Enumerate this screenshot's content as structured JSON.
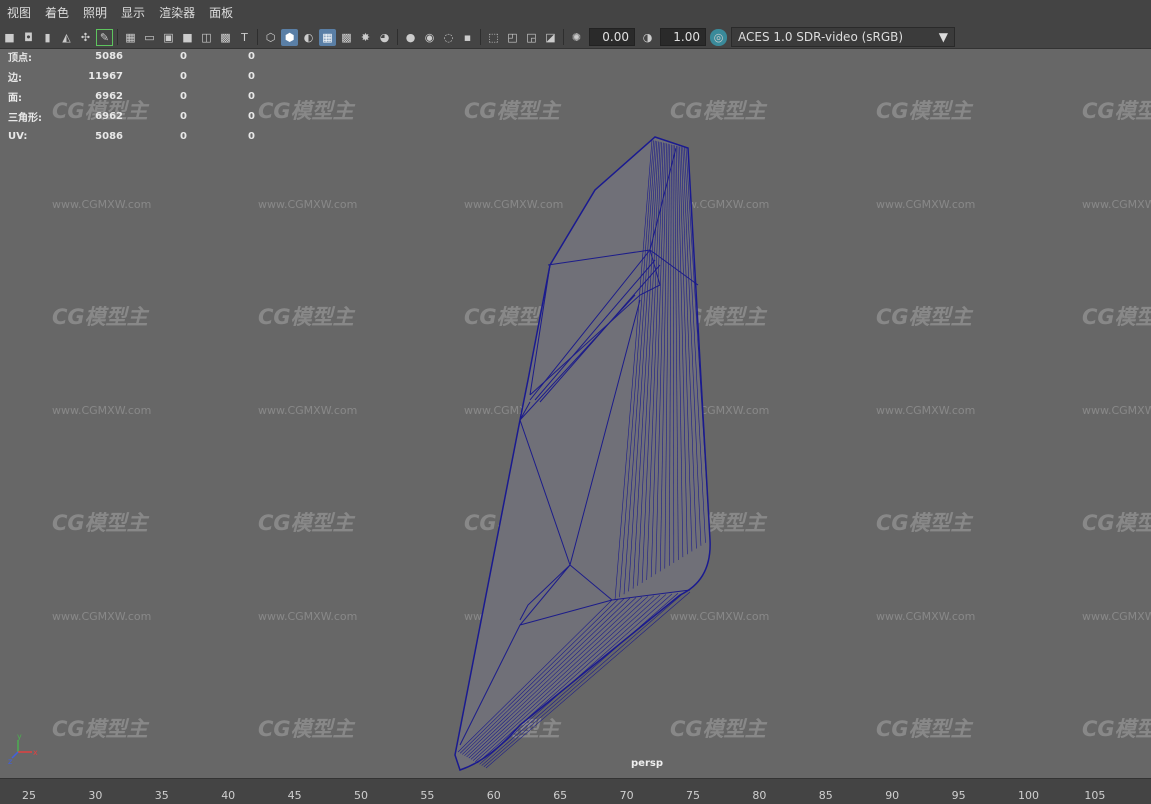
{
  "menu": [
    "视图",
    "着色",
    "照明",
    "显示",
    "渲染器",
    "面板"
  ],
  "toolbar": {
    "exposure_value": "0.00",
    "gamma_value": "1.00",
    "color_space": "ACES 1.0 SDR-video (sRGB)",
    "icons": [
      "camera-icon",
      "camera-attr-icon",
      "bookmark-icon",
      "image-plane-icon",
      "grid-icon",
      "film-gate-icon",
      "resolution-gate-icon",
      "gate-mask-icon",
      "field-chart-icon",
      "safe-action-icon",
      "safe-title-icon",
      "wireframe-icon",
      "smooth-shade-icon",
      "default-material-icon",
      "textured-icon",
      "lights-icon",
      "shadows-icon",
      "ambient-occlusion-icon",
      "motion-blur-icon",
      "anti-alias-icon",
      "depth-of-field-icon",
      "isolate-select-icon",
      "xray-icon",
      "xray-joints-icon",
      "backface-icon",
      "exposure-icon",
      "gamma-icon",
      "color-management-icon"
    ]
  },
  "hud": {
    "rows": [
      {
        "label": "顶点:",
        "v1": "5086",
        "v2": "0",
        "v3": "0"
      },
      {
        "label": "边:",
        "v1": "11967",
        "v2": "0",
        "v3": "0"
      },
      {
        "label": "面:",
        "v1": "6962",
        "v2": "0",
        "v3": "0"
      },
      {
        "label": "三角形:",
        "v1": "6962",
        "v2": "0",
        "v3": "0"
      },
      {
        "label": "UV:",
        "v1": "5086",
        "v2": "0",
        "v3": "0"
      }
    ]
  },
  "camera_label": "persp",
  "axis_labels": {
    "y": "y",
    "x": "x",
    "z": "z"
  },
  "ruler_ticks": [
    "25",
    "30",
    "35",
    "40",
    "45",
    "50",
    "55",
    "60",
    "65",
    "70",
    "75",
    "80",
    "85",
    "90",
    "95",
    "100",
    "105"
  ],
  "watermark": {
    "logo": "CG模型主",
    "url": "www.CGMXW.com"
  },
  "colors": {
    "viewport": "#676767",
    "wire": "#1c1c8a",
    "panel": "#444444",
    "active": "#5a7fa6"
  }
}
